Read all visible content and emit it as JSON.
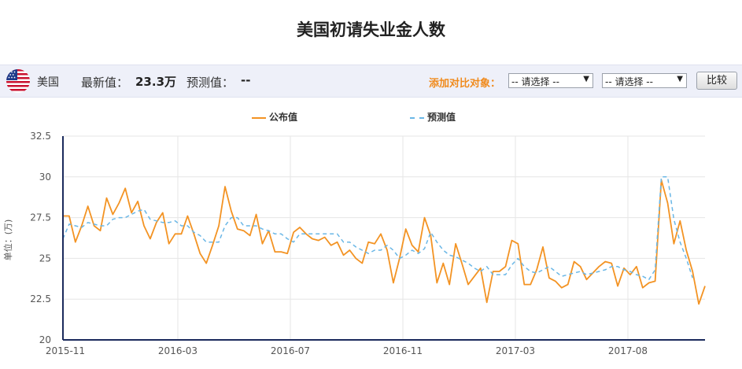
{
  "page": {
    "title": "美国初请失业金人数"
  },
  "info": {
    "country": "美国",
    "latest_label": "最新值：",
    "latest_value": "23.3万",
    "forecast_label": "预测值：",
    "forecast_value": "--",
    "compare_label": "添加对比对象：",
    "select_placeholder_1": "-- 请选择 --",
    "select_placeholder_2": "-- 请选择 --",
    "compare_button": "比较"
  },
  "colors": {
    "published": "#f39323",
    "forecast": "#6ab7e6",
    "grid": "#e6e6e6",
    "axis": "#1b2a5c"
  },
  "chart_data": {
    "type": "line",
    "ylabel": "单位：(万)",
    "ylim": [
      20,
      32.5
    ],
    "yticks": [
      "20",
      "22.5",
      "25",
      "27.5",
      "30",
      "32.5"
    ],
    "yticks_values": [
      20,
      22.5,
      25,
      27.5,
      30,
      32.5
    ],
    "xticks": [
      "2015-11",
      "2016-03",
      "2016-07",
      "2016-11",
      "2017-03",
      "2017-08"
    ],
    "legend_position": "top",
    "grid": true,
    "series": [
      {
        "name": "公布值",
        "style": "solid",
        "values": [
          27.6,
          27.6,
          26.0,
          27.0,
          28.2,
          27.0,
          26.7,
          28.7,
          27.7,
          28.4,
          29.3,
          27.8,
          28.5,
          27.0,
          26.2,
          27.2,
          27.8,
          25.9,
          26.5,
          26.5,
          27.6,
          26.5,
          25.3,
          24.7,
          25.8,
          27.0,
          29.4,
          27.9,
          26.8,
          26.7,
          26.4,
          27.7,
          25.9,
          26.7,
          25.4,
          25.4,
          25.3,
          26.6,
          26.9,
          26.5,
          26.2,
          26.1,
          26.3,
          25.8,
          26.0,
          25.2,
          25.5,
          25.0,
          24.7,
          26.0,
          25.9,
          26.5,
          25.5,
          23.5,
          25.0,
          26.8,
          25.8,
          25.4,
          27.5,
          26.4,
          23.5,
          24.7,
          23.4,
          25.9,
          24.7,
          23.4,
          23.9,
          24.4,
          22.3,
          24.2,
          24.2,
          24.5,
          26.1,
          25.9,
          23.4,
          23.4,
          24.3,
          25.7,
          23.8,
          23.6,
          23.2,
          23.4,
          24.8,
          24.5,
          23.7,
          24.1,
          24.5,
          24.8,
          24.7,
          23.3,
          24.4,
          24.0,
          24.5,
          23.2,
          23.5,
          23.6,
          29.8,
          28.4,
          25.9,
          27.3,
          25.5,
          24.2,
          22.2,
          23.3
        ]
      },
      {
        "name": "预测值",
        "style": "dashed",
        "values": [
          26.2,
          27.1,
          27.0,
          26.9,
          27.2,
          27.1,
          27.0,
          27.0,
          27.4,
          27.5,
          27.5,
          27.7,
          27.9,
          28.0,
          27.4,
          27.3,
          27.2,
          27.2,
          27.3,
          27.0,
          27.0,
          26.6,
          26.4,
          26.0,
          26.0,
          26.0,
          27.0,
          27.5,
          27.5,
          27.0,
          27.0,
          27.0,
          26.8,
          26.7,
          26.5,
          26.5,
          26.2,
          26.0,
          26.5,
          26.5,
          26.5,
          26.5,
          26.5,
          26.5,
          26.5,
          26.0,
          26.0,
          25.7,
          25.5,
          25.3,
          25.5,
          25.5,
          25.8,
          25.5,
          25.0,
          25.2,
          25.5,
          25.3,
          25.6,
          26.6,
          26.0,
          25.5,
          25.2,
          25.1,
          24.9,
          24.7,
          24.4,
          24.2,
          24.5,
          24.0,
          24.0,
          24.0,
          24.6,
          25.0,
          24.5,
          24.2,
          24.1,
          24.3,
          24.5,
          24.2,
          23.9,
          24.0,
          24.1,
          24.2,
          24.0,
          24.1,
          24.2,
          24.3,
          24.5,
          24.5,
          24.3,
          24.2,
          24.0,
          23.9,
          23.7,
          24.3,
          30.0,
          30.0,
          27.4,
          26.0,
          25.0,
          23.8,
          null,
          null
        ]
      }
    ]
  }
}
